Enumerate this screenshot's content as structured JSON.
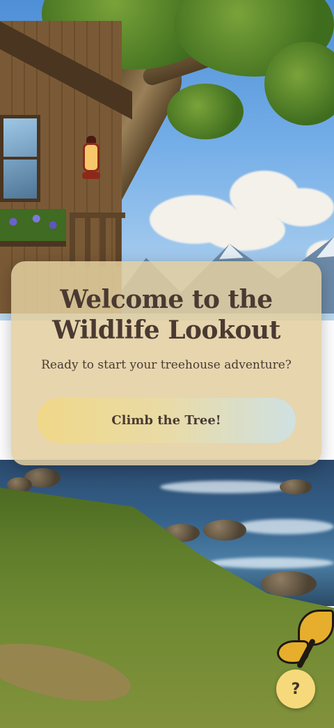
{
  "welcome_card": {
    "title": "Welcome to the\nWildlife Lookout",
    "subtitle": "Ready to start your treehouse adventure?",
    "cta_label": "Climb the Tree!"
  },
  "help_button": {
    "label": "?"
  },
  "colors": {
    "card_background": "#e2cea0",
    "title_text": "#4a3a32",
    "button_gradient_start": "#f0d889",
    "button_gradient_end": "#cfe1e2",
    "help_button": "#f6d97a"
  }
}
